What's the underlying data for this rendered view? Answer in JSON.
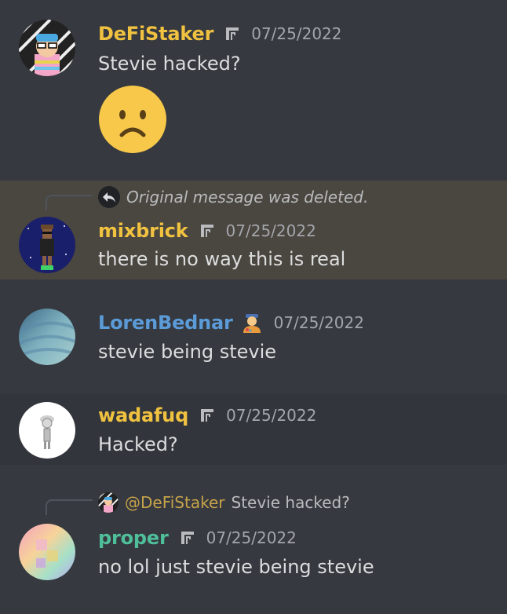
{
  "messages": [
    {
      "username": "DeFiStaker",
      "name_color": "#f0c240",
      "badge": "server-boost-icon",
      "timestamp": "07/25/2022",
      "text": "Stevie hacked?",
      "attachment": "frowning-face-emoji"
    },
    {
      "reply": {
        "icon": "reply-arrow-icon",
        "text": "Original message was deleted."
      },
      "username": "mixbrick",
      "name_color": "#f0c240",
      "badge": "server-boost-icon",
      "timestamp": "07/25/2022",
      "text": "there is no way this is real",
      "highlighted": true
    },
    {
      "username": "LorenBednar",
      "name_color": "#5b9bd8",
      "badge": "artist-emoji",
      "timestamp": "07/25/2022",
      "text": "stevie being stevie"
    },
    {
      "username": "wadafuq",
      "name_color": "#f0c240",
      "badge": "server-boost-icon",
      "timestamp": "07/25/2022",
      "text": "Hacked?"
    },
    {
      "reply": {
        "mention": "@DeFiStaker",
        "text": "Stevie hacked?"
      },
      "username": "proper",
      "name_color": "#4fbf9a",
      "badge": "server-boost-icon",
      "timestamp": "07/25/2022",
      "text": "no lol just stevie being stevie"
    }
  ]
}
